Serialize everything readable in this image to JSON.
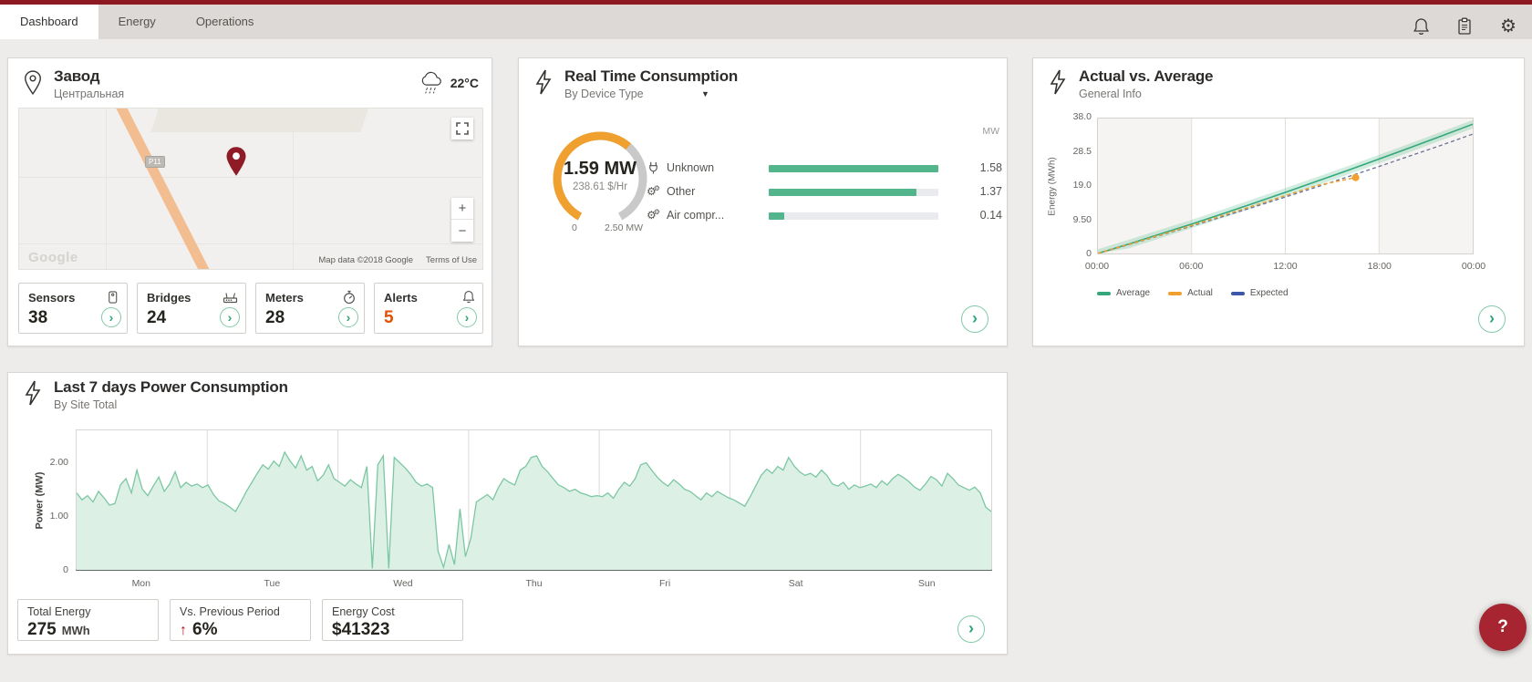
{
  "topbar": {
    "tabs": [
      {
        "label": "Dashboard",
        "active": true
      },
      {
        "label": "Energy",
        "active": false
      },
      {
        "label": "Operations",
        "active": false
      }
    ]
  },
  "icon_glyphs": {
    "gear": "⚙",
    "dropdown": "▼",
    "chevron": "›",
    "plus": "+",
    "minus": "−",
    "up_arrow": "↑",
    "help": "?"
  },
  "site": {
    "title": "Завод",
    "subtitle": "Центральная",
    "temperature": "22°C",
    "map": {
      "logo": "Google",
      "attribution": "Map data ©2018 Google",
      "terms": "Terms of Use",
      "road_label": "P11"
    },
    "stats": [
      {
        "label": "Sensors",
        "value": "38",
        "icon": "sensor-icon"
      },
      {
        "label": "Bridges",
        "value": "24",
        "icon": "bridge-icon"
      },
      {
        "label": "Meters",
        "value": "28",
        "icon": "meter-icon"
      },
      {
        "label": "Alerts",
        "value": "5",
        "icon": "alert-bell-icon",
        "highlight": "#e05206"
      }
    ]
  },
  "realtime": {
    "title": "Real Time Consumption",
    "subtitle": "By Device Type",
    "gauge": {
      "value": "1.59 MW",
      "rate": "238.61 $/Hr",
      "min_label": "0",
      "max_label": "2.50 MW",
      "fraction": 0.636,
      "color": "#efa02e",
      "track_color": "#c9c9c9"
    },
    "devices": [
      {
        "label": "Unknown",
        "value": "1.58",
        "fraction": 1.0,
        "icon": "plug-icon"
      },
      {
        "label": "Other",
        "value": "1.37",
        "fraction": 0.87,
        "icon": "gears-icon"
      },
      {
        "label": "Air compr...",
        "value": "0.14",
        "fraction": 0.09,
        "icon": "gears-icon"
      }
    ],
    "unit": "MW",
    "bar_color": "#52b58c"
  },
  "avg": {
    "title": "Actual vs. Average",
    "subtitle": "General Info"
  },
  "week": {
    "title": "Last 7 days Power Consumption",
    "subtitle": "By Site Total",
    "stats": [
      {
        "label": "Total Energy",
        "value": "275",
        "unit": "MWh"
      },
      {
        "label": "Vs. Previous Period",
        "value": "6%",
        "trend": "up"
      },
      {
        "label": "Energy Cost",
        "value": "$41323"
      }
    ]
  },
  "help_label": "?",
  "chart_data": [
    {
      "id": "actual_vs_average",
      "type": "line",
      "title": "Actual vs. Average",
      "ylabel": "Energy (MWh)",
      "xlabel": "",
      "x_ticks": [
        "00:00",
        "06:00",
        "12:00",
        "18:00",
        "00:00"
      ],
      "y_ticks": [
        "0",
        "9.50",
        "19.0",
        "28.5",
        "38.0"
      ],
      "ylim": [
        0,
        38
      ],
      "xlim_hours": [
        0,
        24
      ],
      "legend": [
        "Average",
        "Actual",
        "Expected"
      ],
      "legend_colors": [
        "#36a77d",
        "#efa02e",
        "#3d57a8"
      ],
      "series": [
        {
          "name": "Average",
          "color": "#36a77d",
          "style": "solid",
          "band": 1.2,
          "x": [
            0,
            2,
            4,
            6,
            8,
            10,
            12,
            14,
            16,
            18,
            20,
            22,
            24
          ],
          "values": [
            0,
            2.7,
            5.5,
            8.3,
            11.2,
            14.2,
            17.2,
            20.3,
            23.4,
            26.6,
            29.8,
            33.1,
            36.4
          ]
        },
        {
          "name": "Actual",
          "color": "#efa02e",
          "style": "dashed",
          "end_dot": true,
          "x": [
            0,
            2,
            4,
            6,
            8,
            10,
            12,
            14,
            16.5
          ],
          "values": [
            0,
            2.6,
            5.2,
            7.9,
            10.7,
            13.5,
            16.3,
            19.1,
            21.4
          ]
        },
        {
          "name": "Expected",
          "color": "#6b7195",
          "style": "dashed",
          "x": [
            0,
            2,
            4,
            6,
            8,
            10,
            12,
            14,
            16,
            18,
            20,
            22,
            24
          ],
          "values": [
            0,
            2.5,
            5.1,
            7.7,
            10.4,
            13.1,
            15.9,
            18.7,
            21.6,
            24.5,
            27.5,
            30.5,
            33.6
          ]
        }
      ]
    },
    {
      "id": "last7days",
      "type": "area",
      "title": "Last 7 days Power Consumption",
      "ylabel": "Power (MW)",
      "categories": [
        "Mon",
        "Tue",
        "Wed",
        "Thu",
        "Fri",
        "Sat",
        "Sun"
      ],
      "y_ticks": [
        "0",
        "1.00",
        "2.00"
      ],
      "ylim": [
        0,
        2.63
      ],
      "line_color": "#7cc7a2",
      "fill_color": "#dcf0e6",
      "values": [
        1.45,
        1.32,
        1.4,
        1.28,
        1.48,
        1.36,
        1.22,
        1.25,
        1.6,
        1.72,
        1.45,
        1.88,
        1.52,
        1.4,
        1.58,
        1.75,
        1.48,
        1.62,
        1.85,
        1.55,
        1.65,
        1.58,
        1.62,
        1.55,
        1.6,
        1.42,
        1.3,
        1.25,
        1.18,
        1.1,
        1.28,
        1.48,
        1.65,
        1.82,
        1.98,
        1.9,
        2.05,
        1.95,
        2.22,
        2.05,
        1.92,
        2.15,
        1.88,
        1.95,
        1.68,
        1.78,
        1.98,
        1.72,
        1.65,
        1.58,
        1.7,
        1.62,
        1.55,
        1.95,
        0.03,
        1.98,
        2.15,
        0.03,
        2.12,
        2.02,
        1.92,
        1.8,
        1.65,
        1.58,
        1.62,
        1.55,
        0.35,
        0.05,
        0.48,
        0.1,
        1.15,
        0.25,
        0.6,
        1.28,
        1.35,
        1.42,
        1.32,
        1.55,
        1.72,
        1.65,
        1.6,
        1.88,
        1.95,
        2.12,
        2.15,
        1.95,
        1.85,
        1.72,
        1.6,
        1.55,
        1.48,
        1.52,
        1.45,
        1.42,
        1.38,
        1.4,
        1.38,
        1.45,
        1.35,
        1.52,
        1.65,
        1.58,
        1.72,
        1.98,
        2.02,
        1.88,
        1.75,
        1.65,
        1.58,
        1.7,
        1.62,
        1.52,
        1.48,
        1.4,
        1.32,
        1.45,
        1.38,
        1.48,
        1.42,
        1.36,
        1.32,
        1.26,
        1.2,
        1.38,
        1.58,
        1.78,
        1.9,
        1.82,
        1.95,
        1.88,
        2.12,
        1.96,
        1.85,
        1.78,
        1.82,
        1.75,
        1.88,
        1.78,
        1.62,
        1.58,
        1.65,
        1.52,
        1.6,
        1.55,
        1.58,
        1.62,
        1.55,
        1.68,
        1.6,
        1.72,
        1.8,
        1.74,
        1.66,
        1.56,
        1.5,
        1.62,
        1.76,
        1.7,
        1.58,
        1.82,
        1.72,
        1.6,
        1.55,
        1.5,
        1.56,
        1.45,
        1.18,
        1.1
      ]
    }
  ]
}
